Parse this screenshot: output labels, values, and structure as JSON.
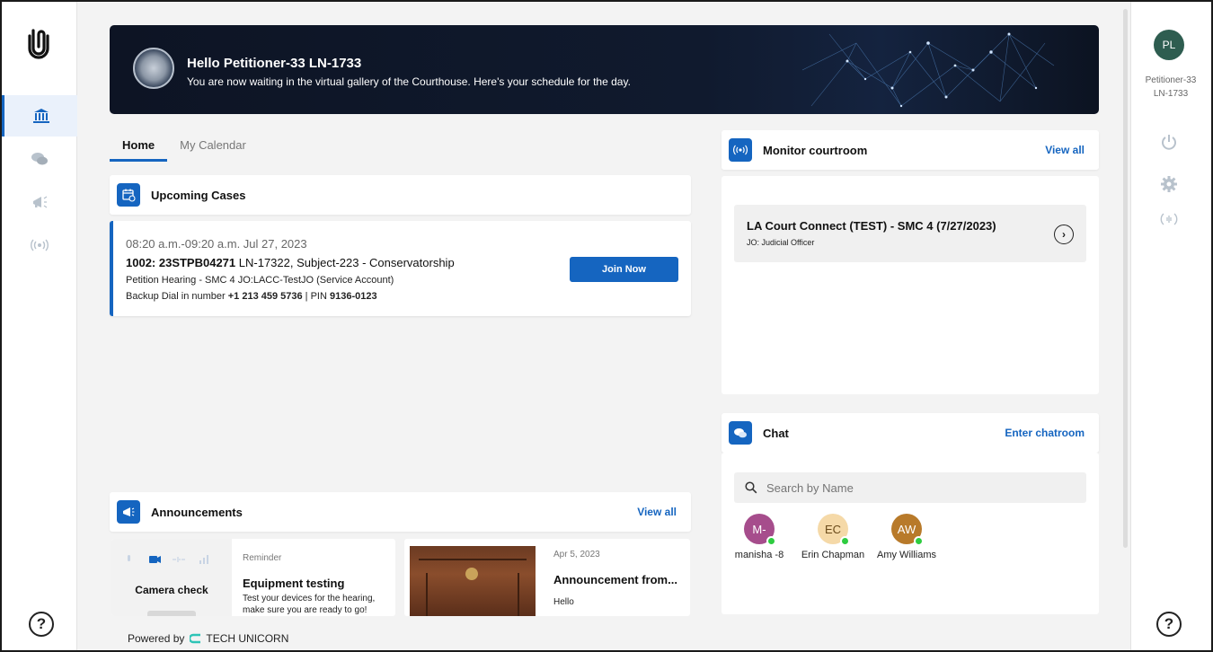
{
  "nav": {
    "logo_icon": "paperclip-logo-icon",
    "items": [
      {
        "icon": "courthouse-icon",
        "active": true
      },
      {
        "icon": "chat-icon",
        "active": false
      },
      {
        "icon": "megaphone-icon",
        "active": false
      },
      {
        "icon": "broadcast-icon",
        "active": false
      }
    ],
    "help": "?"
  },
  "banner": {
    "title": "Hello Petitioner-33 LN-1733",
    "subtitle": "You are now waiting in the virtual gallery of the Courthouse. Here's your schedule for the day."
  },
  "tabs": [
    {
      "label": "Home",
      "active": true
    },
    {
      "label": "My Calendar",
      "active": false
    }
  ],
  "upcoming": {
    "title": "Upcoming Cases",
    "case": {
      "time": "08:20 a.m.-09:20 a.m. Jul 27, 2023",
      "case_number": "1002: 23STPB04271",
      "case_desc": " LN-17322, Subject-223 - Conservatorship",
      "hearing": "Petition Hearing - SMC 4 JO:LACC-TestJO (Service Account)",
      "dial_prefix": "Backup Dial in number ",
      "dial_number": "+1 213 459 5736",
      "pin_prefix": " | PIN ",
      "pin": "9136-0123",
      "join_label": "Join Now"
    }
  },
  "announcements": {
    "title": "Announcements",
    "view_all": "View all",
    "items": [
      {
        "tag": "Reminder",
        "title": "Equipment testing",
        "text": "Test your devices for the hearing, make sure you are ready to go!",
        "thumb_label": "Camera check"
      },
      {
        "tag": "Apr 5, 2023",
        "title": "Announcement from...",
        "text": "Hello"
      }
    ]
  },
  "monitor": {
    "title": "Monitor courtroom",
    "view_all": "View all",
    "room_title": "LA Court Connect (TEST) - SMC 4 (7/27/2023)",
    "room_sub": "JO: Judicial Officer"
  },
  "chat": {
    "title": "Chat",
    "enter_label": "Enter chatroom",
    "search_placeholder": "Search by Name",
    "contacts": [
      {
        "initials": "M-",
        "name": "manisha -8",
        "color": "#a64d8c",
        "text_color": "#ffffff",
        "online": true
      },
      {
        "initials": "EC",
        "name": "Erin Chapman",
        "color": "#f5d9a8",
        "text_color": "#6a4a1a",
        "online": true
      },
      {
        "initials": "AW",
        "name": "Amy Williams",
        "color": "#b87a2a",
        "text_color": "#ffffff",
        "online": true
      }
    ]
  },
  "footer": {
    "powered_by": "Powered by",
    "brand": "TECH UNICORN"
  },
  "profile": {
    "initials": "PL",
    "name_line1": "Petitioner-33",
    "name_line2": "LN-1733"
  },
  "colors": {
    "accent": "#1565c0",
    "online": "#2ecc40",
    "profile_avatar": "#2e5d50"
  }
}
